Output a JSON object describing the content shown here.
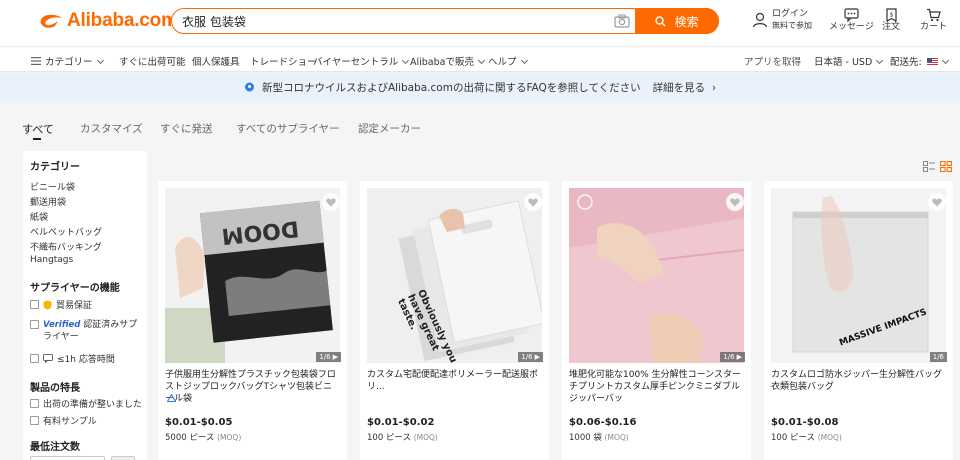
{
  "header": {
    "logo_text": "Alibaba.com",
    "search_value": "衣服 包装袋",
    "search_button": "検索",
    "user_line1": "ログイン",
    "user_line2": "無料で参加",
    "messages": "メッセージ",
    "orders": "注文",
    "cart": "カート"
  },
  "nav": {
    "categories": "カテゴリー",
    "items": [
      "すぐに出荷可能",
      "個人保護具",
      "トレードショー",
      "バイヤーセントラル",
      "Alibabaで販売",
      "ヘルプ"
    ],
    "get_app": "アプリを取得",
    "language": "日本語 - USD",
    "ship_to": "配送先:"
  },
  "banner": {
    "text": "新型コロナウイルスおよびAlibaba.comの出荷に関するFAQを参照してください",
    "link": "詳細を見る"
  },
  "tabs": [
    "すべて",
    "カスタマイズ",
    "すぐに発送",
    "すべてのサプライヤー",
    "認定メーカー"
  ],
  "sidebar": {
    "category_title": "カテゴリー",
    "categories": [
      "ビニール袋",
      "郵送用袋",
      "紙袋",
      "ベルベットバッグ",
      "不織布バッキング",
      "Hangtags"
    ],
    "supplier_title": "サプライヤーの機能",
    "trade_assurance": "貿易保証",
    "verified_badge": "Verified",
    "verified_label": "認証済みサプライヤー",
    "response": "≤1h 応答時間",
    "product_title": "製品の特長",
    "product_items": [
      "出荷の準備が整いました",
      "有料サンプル"
    ],
    "min_order_title": "最低注文数"
  },
  "products": [
    {
      "title": "子供服用生分解性プラスチック包装袋フロストジップロックバッグTシャツ包装ビニール袋",
      "price": "$0.01-$0.05",
      "moq": "5000 ピース",
      "moq_tag": "(MOQ)",
      "pager": "1/6"
    },
    {
      "title": "カスタム宅配便配達ポリメーラー配送服ポリ...",
      "price": "$0.01-$0.02",
      "moq": "100 ピース",
      "moq_tag": "(MOQ)",
      "pager": "1/6",
      "print_text": "Obviously you have great taste."
    },
    {
      "title": "堆肥化可能な100% 生分解性コーンスターチプリントカスタム厚手ピンクミニダブルジッパーバッ",
      "price": "$0.06-$0.16",
      "moq": "1000 袋",
      "moq_tag": "(MOQ)",
      "pager": "1/6"
    },
    {
      "title": "カスタムロゴ防水ジッパー生分解性バッグ衣類包装バッグ",
      "price": "$0.01-$0.08",
      "moq": "100 ピース",
      "moq_tag": "(MOQ)",
      "pager": "1/6",
      "print_text": "MASSIVE IMPACTS"
    }
  ],
  "colors": {
    "brand": "#ff6a00",
    "banner_bg": "#e9f1fb",
    "info": "#2d7ee8"
  }
}
